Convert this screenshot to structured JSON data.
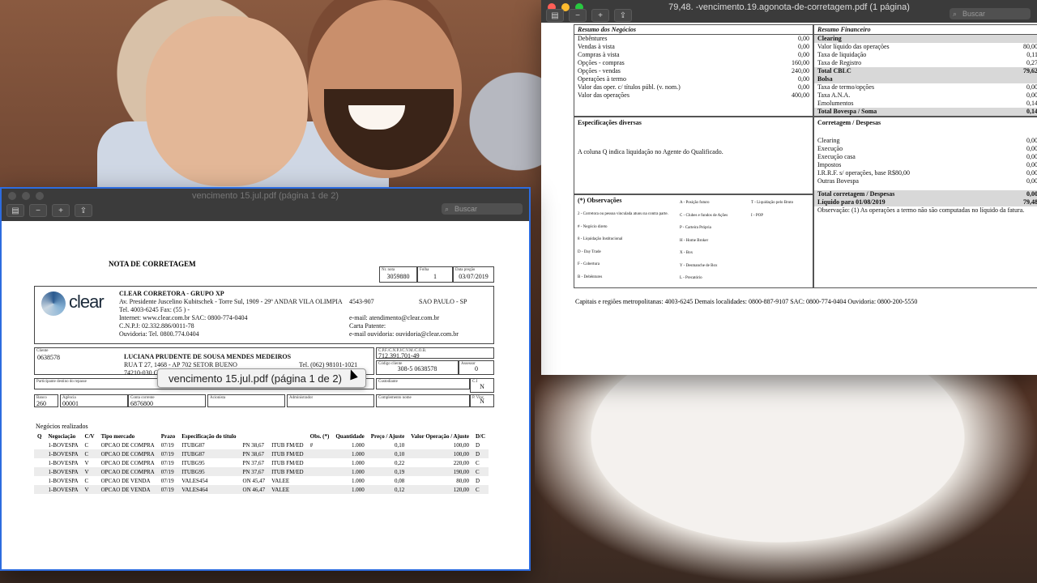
{
  "right_window": {
    "title": "79,48. -vencimento.19.agonota-de-corretagem.pdf (1 página)",
    "search_placeholder": "Buscar",
    "resumo_negocios": {
      "heading": "Resumo dos Negócios",
      "rows": [
        {
          "label": "Debêntures",
          "value": "0,00"
        },
        {
          "label": "Vendas à vista",
          "value": "0,00"
        },
        {
          "label": "Compras à vista",
          "value": "0,00"
        },
        {
          "label": "Opções - compras",
          "value": "160,00"
        },
        {
          "label": "Opções - vendas",
          "value": "240,00"
        },
        {
          "label": "Operações à termo",
          "value": "0,00"
        },
        {
          "label": "Valor das oper. c/ títulos públ. (v. nom.)",
          "value": "0,00"
        },
        {
          "label": "Valor das operações",
          "value": "400,00"
        }
      ]
    },
    "resumo_financeiro": {
      "heading": "Resumo Financeiro",
      "rows": [
        {
          "label": "Clearing",
          "value": "",
          "bold": true
        },
        {
          "label": "Valor líquido das operações",
          "value": "80,00"
        },
        {
          "label": "Taxa de liquidação",
          "value": "0,11"
        },
        {
          "label": "Taxa de Registro",
          "value": "0,27"
        },
        {
          "label": "Total CBLC",
          "value": "79,62",
          "bold": true
        },
        {
          "label": "Bolsa",
          "value": "",
          "bold": true
        },
        {
          "label": "Taxa de termo/opções",
          "value": "0,00"
        },
        {
          "label": "Taxa A.N.A.",
          "value": "0,00"
        },
        {
          "label": "Emolumentos",
          "value": "0,14"
        },
        {
          "label": "Total Bovespa / Soma",
          "value": "0,14",
          "bold": true
        }
      ]
    },
    "especificacoes": {
      "heading": "Especificações diversas",
      "text": "A coluna Q indica liquidação no Agente do Qualificado."
    },
    "corretagem": {
      "heading": "Corretagem / Despesas",
      "rows": [
        {
          "label": "Clearing",
          "value": "0,00"
        },
        {
          "label": "Execução",
          "value": "0,00"
        },
        {
          "label": "Execução casa",
          "value": "0,00"
        },
        {
          "label": "Impostos",
          "value": "0,00"
        },
        {
          "label": "I.R.R.F. s/ operações, base R$80,00",
          "value": "0,00"
        },
        {
          "label": "Outras Bovespa",
          "value": "0,00"
        }
      ],
      "total": {
        "label": "Total corretagem / Despesas",
        "value": "0,00"
      },
      "liquido": {
        "label": "Líquido para 01/08/2019",
        "value": "79,48"
      },
      "observacao": "Observação: (1) As operações a termo não são computadas no líquido da fatura."
    },
    "observacoes": {
      "heading": "(*) Observações",
      "col1": [
        "2 - Corretora ou pessoa vinculada atuou na contra parte.",
        "# - Negócio direto",
        "8 - Liquidação Institucional",
        "D - Day Trade",
        "F - Cobertura",
        "B - Debêntures"
      ],
      "col2": [
        "A - Posição futuro",
        "C - Clubes e fundos de Ações",
        "P - Carteira Própria",
        "H - Home Broker",
        "X - Box",
        "Y - Desmanche de Box",
        "L - Precatório"
      ],
      "col3": [
        "T - Liquidação pelo Bruto",
        "I - POP"
      ]
    },
    "footer": "Capitais e regiões metropolitanas: 4003-6245 Demais localidades: 0800-887-9107 SAC: 0800-774-0404 Ouvidoria: 0800-200-5550"
  },
  "left_window": {
    "title": "vencimento 15.jul.pdf (página 1 de 2)",
    "search_placeholder": "Buscar",
    "nota_title": "NOTA DE CORRETAGEM",
    "nr_nota": {
      "label": "Nr. nota",
      "value": "3059880"
    },
    "folha": {
      "label": "Folha",
      "value": "1"
    },
    "data_pregao": {
      "label": "Data pregão",
      "value": "03/07/2019"
    },
    "broker": {
      "logo_text": "clear",
      "name": "CLEAR CORRETORA - GRUPO XP",
      "address": "Av. Presidente Juscelino Kubitschek - Torre Sul, 1909 - 29º ANDAR VILA OLIMPIA",
      "cep": "4543-907",
      "city": "SAO PAULO - SP",
      "tel": "Tel. 4003-6245   Fax: (55 ) -",
      "internet": "Internet: www.clear.com.br SAC: 0800-774-0404",
      "email": "e-mail: atendimento@clear.com.br",
      "cnpj": "C.N.P.J: 02.332.886/0011-78",
      "carta": "Carta Patente:",
      "ouvidoria": "Ouvidoria: Tel. 0800.774.0404",
      "email_ouv": "e-mail ouvidoria: ouvidoria@clear.com.br"
    },
    "cliente": {
      "label": "Cliente",
      "code": "0638578",
      "name": "LUCIANA PRUDENTE DE SOUSA MENDES  MEDEIROS",
      "address": "RUA T 27, 1468 - AP 702 SETOR BUENO",
      "cep": "74210-030 GO",
      "tel": "Tel. (062) 98101-1021",
      "cpf_label": "C.P.F./C.N.P.J/C.V.M./C.O.B.",
      "cpf": "712.391.701-49",
      "codigo_label": "Código cliente",
      "codigo": "308-5  0638578",
      "assessor_label": "Assessor",
      "assessor": "0"
    },
    "participante_label": "Participante destino do repasse",
    "custodiante_label": "Custodiante",
    "ci_label": "C.I",
    "ci_value": "N",
    "banco": {
      "label": "Banco",
      "value": "260"
    },
    "agencia": {
      "label": "Agência",
      "value": "00001"
    },
    "conta": {
      "label": "Conta corrente",
      "value": "6876800"
    },
    "acionista_label": "Acionista",
    "administrador_label": "Administrador",
    "complemento_label": "Complemento nome",
    "pvinc": {
      "label": "P. Vinc",
      "value": "N"
    },
    "negocios_heading": "Negócios realizados",
    "columns": [
      "Q",
      "Negociação",
      "C/V",
      "Tipo mercado",
      "Prazo",
      "Especificação do título",
      "",
      "",
      "Obs. (*)",
      "Quantidade",
      "Preço / Ajuste",
      "Valor Operação / Ajuste",
      "D/C"
    ],
    "rows": [
      [
        "",
        "1-BOVESPA",
        "C",
        "OPCAO DE COMPRA",
        "07/19",
        "ITUBG87",
        "PN 38,67",
        "ITUB FM/ED",
        "#",
        "1.000",
        "0,10",
        "100,00",
        "D"
      ],
      [
        "",
        "1-BOVESPA",
        "C",
        "OPCAO DE COMPRA",
        "07/19",
        "ITUBG87",
        "PN 38,67",
        "ITUB FM/ED",
        "",
        "1.000",
        "0,10",
        "100,00",
        "D"
      ],
      [
        "",
        "1-BOVESPA",
        "V",
        "OPCAO DE COMPRA",
        "07/19",
        "ITUBG95",
        "PN 37,67",
        "ITUB FM/ED",
        "",
        "1.000",
        "0,22",
        "220,00",
        "C"
      ],
      [
        "",
        "1-BOVESPA",
        "V",
        "OPCAO DE COMPRA",
        "07/19",
        "ITUBG95",
        "PN 37,67",
        "ITUB FM/ED",
        "",
        "1.000",
        "0,19",
        "190,00",
        "C"
      ],
      [
        "",
        "1-BOVESPA",
        "C",
        "OPCAO DE VENDA",
        "07/19",
        "VALES454",
        "ON 45,47",
        "VALEE",
        "",
        "1.000",
        "0,08",
        "80,00",
        "D"
      ],
      [
        "",
        "1-BOVESPA",
        "V",
        "OPCAO DE VENDA",
        "07/19",
        "VALES464",
        "ON 46,47",
        "VALEE",
        "",
        "1.000",
        "0,12",
        "120,00",
        "C"
      ]
    ],
    "tooltip": "vencimento 15.jul.pdf (página 1 de 2)"
  }
}
